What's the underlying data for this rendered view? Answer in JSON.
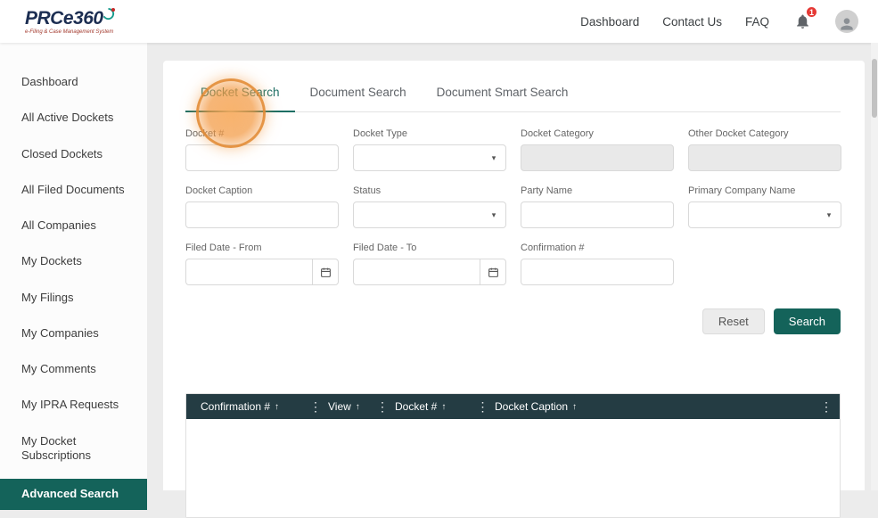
{
  "colors": {
    "accent_teal": "#14635a",
    "table_header_dark": "#243c43",
    "highlight_orange": "#f29942",
    "badge_red": "#e53935",
    "logo_navy": "#1c2e52"
  },
  "header": {
    "logo_text": "PRCe360",
    "tagline": "e-Filing & Case Management System",
    "nav": [
      {
        "label": "Dashboard"
      },
      {
        "label": "Contact Us"
      },
      {
        "label": "FAQ"
      }
    ],
    "notification_count": "1"
  },
  "sidebar": {
    "items": [
      {
        "label": "Dashboard"
      },
      {
        "label": "All Active Dockets"
      },
      {
        "label": "Closed Dockets"
      },
      {
        "label": "All Filed Documents"
      },
      {
        "label": "All Companies"
      },
      {
        "label": "My Dockets"
      },
      {
        "label": "My Filings"
      },
      {
        "label": "My Companies"
      },
      {
        "label": "My Comments"
      },
      {
        "label": "My IPRA Requests"
      },
      {
        "label": "My Docket Subscriptions"
      },
      {
        "label": "Advanced Search"
      }
    ]
  },
  "tabs": [
    {
      "label": "Docket Search"
    },
    {
      "label": "Document Search"
    },
    {
      "label": "Document Smart Search"
    }
  ],
  "form": {
    "fields": [
      {
        "label": "Docket #",
        "value": ""
      },
      {
        "label": "Docket Type",
        "value": ""
      },
      {
        "label": "Docket Category",
        "value": ""
      },
      {
        "label": "Other Docket Category",
        "value": ""
      },
      {
        "label": "Docket Caption",
        "value": ""
      },
      {
        "label": "Status",
        "value": ""
      },
      {
        "label": "Party Name",
        "value": ""
      },
      {
        "label": "Primary Company Name",
        "value": ""
      },
      {
        "label": "Filed Date - From",
        "value": ""
      },
      {
        "label": "Filed Date - To",
        "value": ""
      },
      {
        "label": "Confirmation #",
        "value": ""
      }
    ],
    "reset_label": "Reset",
    "search_label": "Search"
  },
  "table": {
    "columns": [
      {
        "label": "Confirmation #"
      },
      {
        "label": "View"
      },
      {
        "label": "Docket #"
      },
      {
        "label": "Docket Caption"
      }
    ],
    "rows": []
  },
  "icons": {
    "sort_asc": "↑",
    "column_menu": "⋮",
    "caret": "▾"
  }
}
